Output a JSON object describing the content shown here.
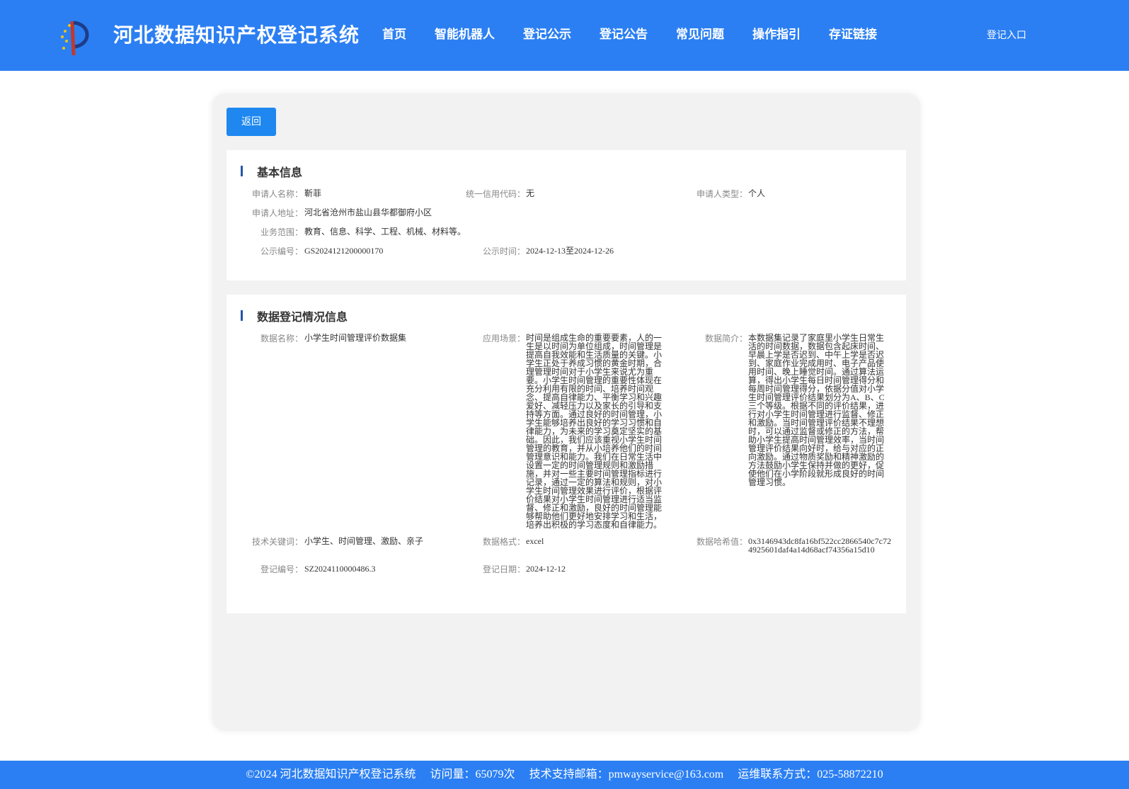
{
  "header": {
    "site_title": "河北数据知识产权登记系统",
    "nav": [
      "首页",
      "智能机器人",
      "登记公示",
      "登记公告",
      "常见问题",
      "操作指引",
      "存证链接"
    ],
    "login": "登记入口"
  },
  "main": {
    "back_label": "返回",
    "basic": {
      "title": "基本信息",
      "applicant_name_label": "申请人名称：",
      "applicant_name": "靳菲",
      "credit_code_label": "统一信用代码：",
      "credit_code": "无",
      "applicant_type_label": "申请人类型：",
      "applicant_type": "个人",
      "address_label": "申请人地址：",
      "address": "河北省沧州市盐山县华都御府小区",
      "scope_label": "业务范围：",
      "scope": "教育、信息、科学、工程、机械、材料等。",
      "notice_no_label": "公示编号：",
      "notice_no": "GS2024121200000170",
      "notice_time_label": "公示时间：",
      "notice_time": "2024-12-13至2024-12-26"
    },
    "data": {
      "title": "数据登记情况信息",
      "name_label": "数据名称：",
      "name": "小学生时间管理评价数据集",
      "scenario_label": "应用场景：",
      "scenario": "时间是组成生命的重要要素，人的一生是以时间为单位组成，时间管理是提高自我效能和生活质量的关键。小学生正处于养成习惯的黄金时期，合理管理时间对于小学生来说尤为重要。小学生时间管理的重要性体现在充分利用有限的时间、培养时间观念、提高自律能力、平衡学习和兴趣爱好、减轻压力以及家长的引导和支持等方面。通过良好的时间管理，小学生能够培养出良好的学习习惯和自律能力，为未来的学习奠定坚实的基础。因此，我们应该重视小学生时间管理的教育，并从小培养他们的时间管理意识和能力。我们在日常生活中设置一定的时间管理规则和激励措施，并对一些主要时间管理指标进行记录，通过一定的算法和规则，对小学生时间管理效果进行评价，根据评价结果对小学生时间管理进行适当监督、修正和激励，良好的时间管理能够帮助他们更好地安排学习和生活，培养出积极的学习态度和自律能力。",
      "intro_label": "数据简介：",
      "intro": "本数据集记录了家庭里小学生日常生活的时间数据，数据包含起床时间、早晨上学是否迟到、中午上学是否迟到、家庭作业完成用时、电子产品使用时间、晚上睡觉时间。通过算法运算，得出小学生每日时间管理得分和每周时间管理得分，依据分值对小学生时间管理评价结果划分为A、B、C三个等级。根据不同的评价结果，进行对小学生时间管理进行监督、修正和激励。当时间管理评价结果不理想时，可以通过监督或修正的方法，帮助小学生提高时间管理效率，当时间管理评价结果向好时，给与对应的正向激励。通过物质奖励和精神激励的方法鼓励小学生保持并做的更好，促使他们在小学阶段就形成良好的时间管理习惯。",
      "keywords_label": "技术关键词：",
      "keywords": "小学生、时间管理、激励、亲子",
      "format_label": "数据格式：",
      "format": "excel",
      "hash_label": "数据哈希值：",
      "hash": "0x3146943dc8fa16bf522cc2866540c7c724925601daf4a14d68acf74356a15d10",
      "reg_no_label": "登记编号：",
      "reg_no": "SZ2024110000486.3",
      "reg_date_label": "登记日期：",
      "reg_date": "2024-12-12"
    }
  },
  "footer": {
    "copyright": "©2024 河北数据知识产权登记系统",
    "visits": "访问量：65079次",
    "email": "技术支持邮箱：pmwayservice@163.com",
    "contact": "运维联系方式：025-58872210"
  }
}
